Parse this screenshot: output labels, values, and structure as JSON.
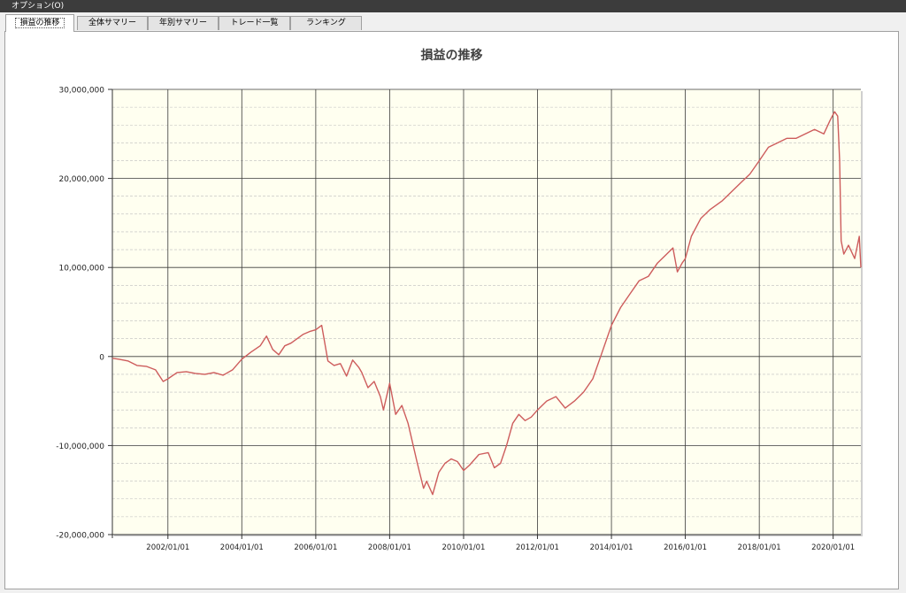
{
  "window": {
    "title": "オプション(O)"
  },
  "tabs": [
    {
      "label": "損益の推移",
      "active": true
    },
    {
      "label": "全体サマリー",
      "active": false
    },
    {
      "label": "年別サマリー",
      "active": false
    },
    {
      "label": "トレード一覧",
      "active": false
    },
    {
      "label": "ランキング",
      "active": false
    }
  ],
  "colors": {
    "plot_background": "#fffff0",
    "series": "#cd5c5c",
    "titlebar": "#3c3c3c"
  },
  "chart_data": {
    "type": "line",
    "title": "損益の推移",
    "xlabel": "",
    "ylabel": "",
    "ylim": [
      -20000000,
      30000000
    ],
    "xlim": [
      "2000-07-01",
      "2020-10-01"
    ],
    "y_ticks": [
      -20000000,
      -10000000,
      0,
      10000000,
      20000000,
      30000000
    ],
    "y_tick_labels": [
      "-20,000,000",
      "-10,000,000",
      "0",
      "10,000,000",
      "20,000,000",
      "30,000,000"
    ],
    "x_ticks": [
      "2002-01-01",
      "2004-01-01",
      "2006-01-01",
      "2008-01-01",
      "2010-01-01",
      "2012-01-01",
      "2014-01-01",
      "2016-01-01",
      "2018-01-01",
      "2020-01-01"
    ],
    "x_tick_labels": [
      "2002/01/01",
      "2004/01/01",
      "2006/01/01",
      "2008/01/01",
      "2010/01/01",
      "2012/01/01",
      "2014/01/01",
      "2016/01/01",
      "2018/01/01",
      "2020/01/01"
    ],
    "grid": true,
    "series": [
      {
        "x": [
          "2000-07-01",
          "2000-09-01",
          "2000-12-01",
          "2001-03-01",
          "2001-06-01",
          "2001-09-01",
          "2001-11-15",
          "2002-01-01",
          "2002-04-01",
          "2002-07-01",
          "2002-10-01",
          "2003-01-01",
          "2003-04-01",
          "2003-07-01",
          "2003-10-01",
          "2004-01-01",
          "2004-04-01",
          "2004-07-01",
          "2004-09-01",
          "2004-11-01",
          "2005-01-01",
          "2005-03-01",
          "2005-05-01",
          "2005-07-01",
          "2005-09-01",
          "2005-11-01",
          "2006-01-01",
          "2006-03-01",
          "2006-05-01",
          "2006-07-01",
          "2006-09-01",
          "2006-11-01",
          "2007-01-01",
          "2007-03-01",
          "2007-04-01",
          "2007-06-01",
          "2007-08-01",
          "2007-10-01",
          "2007-11-01",
          "2008-01-01",
          "2008-03-01",
          "2008-05-01",
          "2008-07-01",
          "2008-08-01",
          "2008-10-01",
          "2008-12-01",
          "2009-01-01",
          "2009-03-01",
          "2009-05-01",
          "2009-07-01",
          "2009-09-01",
          "2009-11-01",
          "2010-01-01",
          "2010-03-01",
          "2010-06-01",
          "2010-09-01",
          "2010-11-01",
          "2011-01-01",
          "2011-03-01",
          "2011-05-01",
          "2011-07-01",
          "2011-09-01",
          "2011-11-01",
          "2012-01-01",
          "2012-04-01",
          "2012-07-01",
          "2012-10-01",
          "2013-01-01",
          "2013-04-01",
          "2013-07-01",
          "2013-10-01",
          "2014-01-01",
          "2014-04-01",
          "2014-07-01",
          "2014-10-01",
          "2015-01-01",
          "2015-04-01",
          "2015-07-01",
          "2015-09-01",
          "2015-10-15",
          "2015-12-01",
          "2016-01-01",
          "2016-03-01",
          "2016-06-01",
          "2016-09-01",
          "2017-01-01",
          "2017-04-01",
          "2017-07-01",
          "2017-10-01",
          "2018-01-01",
          "2018-04-01",
          "2018-07-01",
          "2018-10-01",
          "2019-01-01",
          "2019-04-01",
          "2019-07-01",
          "2019-10-01",
          "2019-12-01",
          "2020-01-15",
          "2020-02-15",
          "2020-03-05",
          "2020-03-20",
          "2020-04-15",
          "2020-06-01",
          "2020-08-01",
          "2020-09-15",
          "2020-10-01"
        ],
        "values": [
          -200000,
          -300000,
          -500000,
          -1000000,
          -1100000,
          -1500000,
          -2800000,
          -2500000,
          -1800000,
          -1700000,
          -1900000,
          -2000000,
          -1800000,
          -2100000,
          -1500000,
          -300000,
          500000,
          1200000,
          2300000,
          800000,
          200000,
          1200000,
          1500000,
          2000000,
          2500000,
          2800000,
          3000000,
          3500000,
          -500000,
          -1000000,
          -800000,
          -2200000,
          -400000,
          -1200000,
          -1800000,
          -3500000,
          -2800000,
          -4500000,
          -6000000,
          -3000000,
          -6500000,
          -5500000,
          -7500000,
          -9000000,
          -12000000,
          -14800000,
          -14000000,
          -15500000,
          -13000000,
          -12000000,
          -11500000,
          -11800000,
          -12800000,
          -12200000,
          -11000000,
          -10800000,
          -12500000,
          -12000000,
          -10000000,
          -7500000,
          -6500000,
          -7200000,
          -6800000,
          -6000000,
          -5000000,
          -4500000,
          -5800000,
          -5000000,
          -4000000,
          -2500000,
          500000,
          3500000,
          5500000,
          7000000,
          8500000,
          9000000,
          10500000,
          11500000,
          12200000,
          9500000,
          10500000,
          11000000,
          13500000,
          15500000,
          16500000,
          17500000,
          18500000,
          19500000,
          20500000,
          22000000,
          23500000,
          24000000,
          24500000,
          24500000,
          25000000,
          25500000,
          25000000,
          26500000,
          27500000,
          27000000,
          22000000,
          13000000,
          11500000,
          12500000,
          11000000,
          13500000,
          10000000
        ]
      }
    ]
  }
}
